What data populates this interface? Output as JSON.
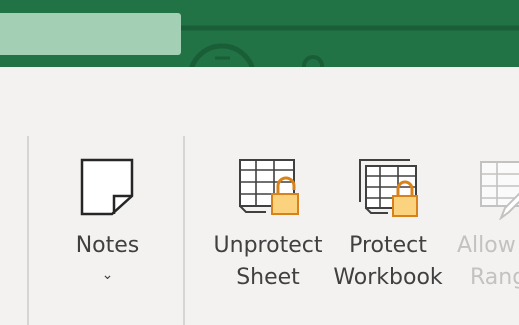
{
  "titlebar": {
    "background": "#217346"
  },
  "search": {
    "background": "#a3cfb5",
    "placeholder": ""
  },
  "ribbon": {
    "buttons": [
      {
        "id": "notes",
        "label": "Notes",
        "icon": "note-icon",
        "has_dropdown": true,
        "enabled": true
      },
      {
        "id": "unprotect-sheet",
        "line1": "Unprotect",
        "line2": "Sheet",
        "icon": "unprotect-sheet-icon",
        "enabled": true
      },
      {
        "id": "protect-workbook",
        "line1": "Protect",
        "line2": "Workbook",
        "icon": "protect-workbook-icon",
        "enabled": true
      },
      {
        "id": "allow-ranges",
        "line1": "Allow",
        "line2": "Rang",
        "icon": "allow-edit-ranges-icon",
        "enabled": false
      }
    ],
    "colors": {
      "lock_fill": "#fbd37f",
      "lock_stroke": "#d9821a",
      "text": "#404040",
      "disabled_text": "#c3c2c0"
    }
  }
}
